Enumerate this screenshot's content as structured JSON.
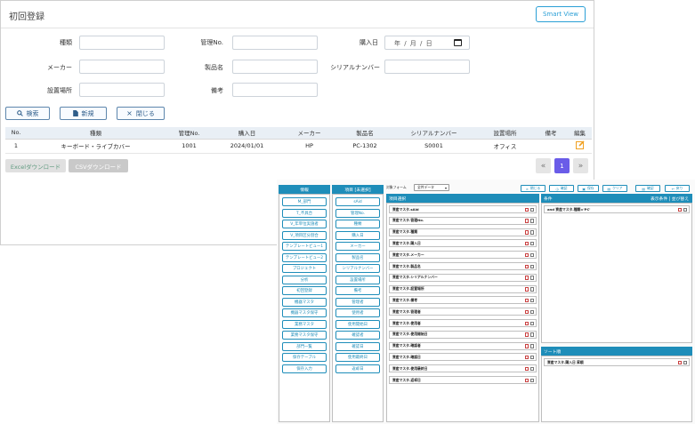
{
  "main": {
    "title": "初回登録",
    "smart_view_label": "Smart View",
    "form": {
      "type_label": "種類",
      "mgmt_no_label": "管理No.",
      "purchase_date_label": "購入日",
      "purchase_date_placeholder": "年 / 月 / 日",
      "maker_label": "メーカー",
      "product_label": "製品名",
      "serial_label": "シリアルナンバー",
      "location_label": "設置場所",
      "notes_label": "備考"
    },
    "buttons": {
      "search": "検索",
      "new": "新規",
      "close": "閉じる"
    },
    "table": {
      "headers": [
        "No.",
        "種類",
        "管理No.",
        "購入日",
        "メーカー",
        "製品名",
        "シリアルナンバー",
        "設置場所",
        "備考",
        "編集"
      ],
      "rows": [
        {
          "no": "1",
          "type": "キーボード・ライブカバー",
          "mgmt_no": "1001",
          "date": "2024/01/01",
          "maker": "HP",
          "product": "PC-1302",
          "serial": "S0001",
          "location": "オフィス",
          "notes": ""
        }
      ]
    },
    "excel_download": "Excelダウンロード",
    "csv_download": "CSVダウンロード",
    "pagination": {
      "prev": "«",
      "current": "1",
      "next": "»"
    }
  },
  "overlay": {
    "info_header": "情報",
    "info_items": [
      "M_部門",
      "T_不具合",
      "V_年単位実施者",
      "V_項目区分割合",
      "テンプレートビュー1",
      "テンプレートビュー2",
      "プロジェクト",
      "分析",
      "初回登録",
      "機器マスタ",
      "機器マスタ保守",
      "業務マスタ",
      "業務マスタ保守",
      "部門一覧",
      "保存テーブル",
      "保存入力"
    ],
    "field_header": "項目 [未選択]",
    "field_items": [
      "sAid",
      "管理No.",
      "種類",
      "購入日",
      "メーカー",
      "製品名",
      "シリアルナンバー",
      "設置場所",
      "備考",
      "管理者",
      "使用者",
      "使用開始日",
      "確認者",
      "確認日",
      "使用最終日",
      "返却日"
    ],
    "target_label": "対象フォーム",
    "target_select": "全件データ",
    "top_buttons": [
      "閉じる",
      "確認",
      "保存",
      "クリア",
      "確認",
      "戻り"
    ],
    "list_header": "項目選択",
    "list_items": [
      "資産マスタ.sAid",
      "資産マスタ.管理No.",
      "資産マスタ.種類",
      "資産マスタ.購入日",
      "資産マスタ.メーカー",
      "資産マスタ.製品名",
      "資産マスタ.シリアルナンバー",
      "資産マスタ.設置場所",
      "資産マスタ.備考",
      "資産マスタ.管理者",
      "資産マスタ.使用者",
      "資産マスタ.使用開始日",
      "資産マスタ.確認者",
      "資産マスタ.確認日",
      "資産マスタ.使用最終日",
      "資産マスタ.返却日"
    ],
    "cond_header": "条件",
    "cond_meta": "表示条件 | 並び替え",
    "cond_item": "and 資産マスタ.種類='PC'",
    "sort_header": "ソート順",
    "sort_item": "資産マスタ.購入日 昇順"
  },
  "colors": {
    "accent": "#1e8db9",
    "primary": "#2a9fd6",
    "page_active": "#6a5ce8",
    "edit_icon": "#f0a020"
  }
}
